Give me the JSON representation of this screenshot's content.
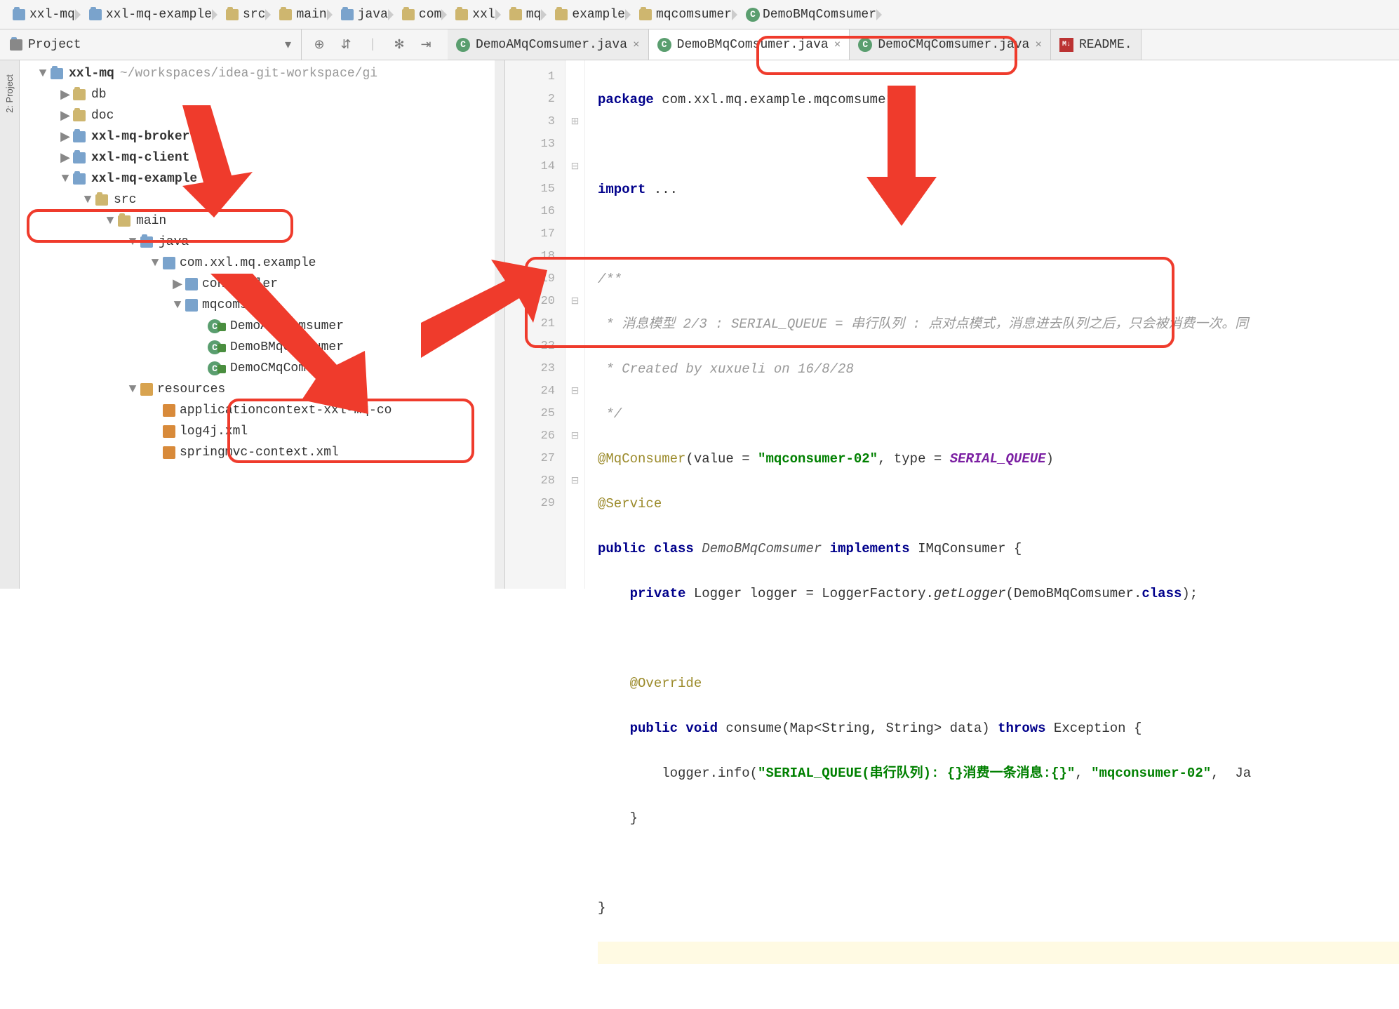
{
  "breadcrumbs": [
    {
      "label": "xxl-mq",
      "icon": "module"
    },
    {
      "label": "xxl-mq-example",
      "icon": "module"
    },
    {
      "label": "src",
      "icon": "folder"
    },
    {
      "label": "main",
      "icon": "folder"
    },
    {
      "label": "java",
      "icon": "folder"
    },
    {
      "label": "com",
      "icon": "folder"
    },
    {
      "label": "xxl",
      "icon": "folder"
    },
    {
      "label": "mq",
      "icon": "folder"
    },
    {
      "label": "example",
      "icon": "folder"
    },
    {
      "label": "mqcomsumer",
      "icon": "folder"
    },
    {
      "label": "DemoBMqComsumer",
      "icon": "class"
    }
  ],
  "project_tool": {
    "label": "Project"
  },
  "side_strip": {
    "label": "2: Project"
  },
  "tabs": [
    {
      "label": "DemoAMqComsumer.java",
      "icon": "class",
      "active": false
    },
    {
      "label": "DemoBMqComsumer.java",
      "icon": "class",
      "active": true
    },
    {
      "label": "DemoCMqComsumer.java",
      "icon": "class",
      "active": false
    },
    {
      "label": "README.",
      "icon": "md",
      "active": false
    }
  ],
  "tree": [
    {
      "d": 0,
      "arrow": "▼",
      "bold": true,
      "icon": "module",
      "name": "xxl-mq",
      "extra": "~/workspaces/idea-git-workspace/gi"
    },
    {
      "d": 1,
      "arrow": "▶",
      "icon": "folder",
      "name": "db"
    },
    {
      "d": 1,
      "arrow": "▶",
      "icon": "folder",
      "name": "doc"
    },
    {
      "d": 1,
      "arrow": "▶",
      "bold": true,
      "icon": "module",
      "name": "xxl-mq-broker"
    },
    {
      "d": 1,
      "arrow": "▶",
      "bold": true,
      "icon": "module",
      "name": "xxl-mq-client"
    },
    {
      "d": 1,
      "arrow": "▼",
      "bold": true,
      "icon": "module",
      "name": "xxl-mq-example"
    },
    {
      "d": 2,
      "arrow": "▼",
      "icon": "folder",
      "name": "src"
    },
    {
      "d": 3,
      "arrow": "▼",
      "icon": "folder",
      "name": "main"
    },
    {
      "d": 4,
      "arrow": "▼",
      "icon": "module",
      "name": "java"
    },
    {
      "d": 5,
      "arrow": "▼",
      "icon": "pkg",
      "name": "com.xxl.mq.example"
    },
    {
      "d": 6,
      "arrow": "▶",
      "icon": "pkg",
      "name": "controller"
    },
    {
      "d": 6,
      "arrow": "▼",
      "icon": "pkg",
      "name": "mqcomsumer"
    },
    {
      "d": 7,
      "arrow": "",
      "icon": "class",
      "lock": true,
      "name": "DemoAMqComsumer"
    },
    {
      "d": 7,
      "arrow": "",
      "icon": "class",
      "lock": true,
      "name": "DemoBMqComsumer"
    },
    {
      "d": 7,
      "arrow": "",
      "icon": "class",
      "lock": true,
      "name": "DemoCMqComsumer"
    },
    {
      "d": 4,
      "arrow": "▼",
      "icon": "res",
      "name": "resources"
    },
    {
      "d": 5,
      "arrow": "",
      "icon": "xml",
      "name": "applicationcontext-xxl-mq-co"
    },
    {
      "d": 5,
      "arrow": "",
      "icon": "xml",
      "name": "log4j.xml"
    },
    {
      "d": 5,
      "arrow": "",
      "icon": "xml",
      "name": "springmvc-context.xml"
    }
  ],
  "gutter": [
    "1",
    "2",
    "3",
    "13",
    "14",
    "15",
    "16",
    "17",
    "18",
    "19",
    "20",
    "21",
    "22",
    "23",
    "24",
    "25",
    "26",
    "27",
    "28",
    "29"
  ],
  "fold": [
    "",
    "",
    "⊞",
    "",
    "⊟",
    "",
    "",
    "",
    "",
    "",
    "⊟",
    "",
    "",
    "",
    "⊟",
    "",
    "⊟",
    "",
    "⊟",
    ""
  ],
  "code": {
    "l1a": "package",
    "l1b": " com.xxl.mq.example.mqcomsumer;",
    "l3a": "import",
    "l3b": " ...",
    "c1": "/**",
    "c2": " * 消息模型 2/3 : SERIAL_QUEUE = 串行队列 : 点对点模式，消息进去队列之后，只会被消费一次。同",
    "c3": " * Created by xuxueli on 16/8/28",
    "c4": " */",
    "a1": "@MqConsumer",
    "a1b": "(value = ",
    "a1s": "\"mqconsumer-02\"",
    "a1c": ", type = ",
    "a1k": "SERIAL_QUEUE",
    "a1e": ")",
    "a2": "@Service",
    "cd1": "public class",
    "cd2": " DemoBMqComsumer ",
    "cd3": "implements",
    "cd4": " IMqConsumer {",
    "fl1": "private",
    "fl2": " Logger logger = LoggerFactory.",
    "fl3": "getLogger",
    "fl4": "(DemoBMqComsumer.",
    "fl5": "class",
    "fl6": ");",
    "ov": "@Override",
    "m1": "public void",
    "m2": " consume(Map<String, String> data) ",
    "m3": "throws",
    "m4": " Exception {",
    "lg1": "logger.info(",
    "lg2": "\"SERIAL_QUEUE(串行队列): {}消费一条消息:{}\"",
    "lg3": ", ",
    "lg4": "\"mqconsumer-02\"",
    "lg5": ",  Ja",
    "cb1": "}",
    "cb2": "}"
  }
}
